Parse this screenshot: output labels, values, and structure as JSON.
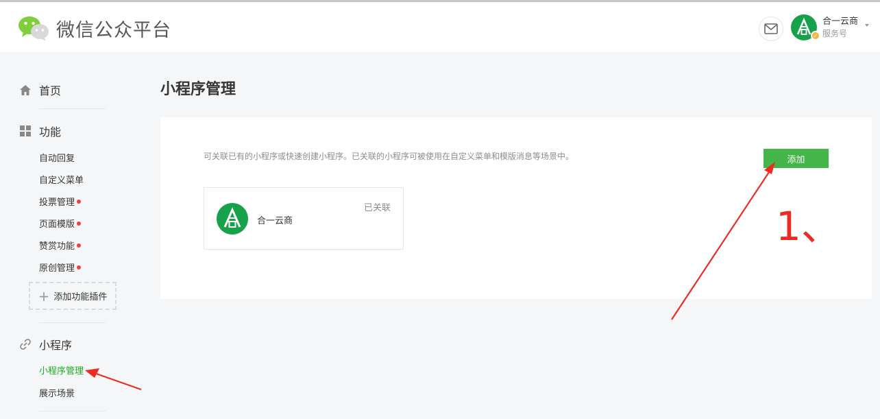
{
  "header": {
    "title": "微信公众平台",
    "account_name": "合一云商",
    "account_type": "服务号",
    "icons": {
      "logo": "wechat-logo-icon",
      "mail": "mail-icon",
      "caret": "chevron-down-icon"
    }
  },
  "sidebar": {
    "home": "首页",
    "features": {
      "title": "功能",
      "items": [
        {
          "label": "自动回复",
          "dot": false
        },
        {
          "label": "自定义菜单",
          "dot": false
        },
        {
          "label": "投票管理",
          "dot": true
        },
        {
          "label": "页面模版",
          "dot": true
        },
        {
          "label": "赞赏功能",
          "dot": true
        },
        {
          "label": "原创管理",
          "dot": true
        }
      ],
      "add_plugin": "添加功能插件"
    },
    "miniprogram": {
      "title": "小程序",
      "items": [
        {
          "label": "小程序管理",
          "active": true
        },
        {
          "label": "展示场景",
          "active": false
        }
      ]
    }
  },
  "main": {
    "title": "小程序管理",
    "description": "可关联已有的小程序或快速创建小程序。已关联的小程序可被使用在自定义菜单和模版消息等场景中。",
    "add_button": "添加",
    "linked": {
      "name": "合一云商",
      "status": "已关联"
    }
  },
  "annotation": {
    "text": "1、"
  },
  "colors": {
    "accent_green": "#44b549",
    "active_text": "#1aad19",
    "red_dot": "#e64340",
    "annotation_red": "#ee2a22"
  }
}
